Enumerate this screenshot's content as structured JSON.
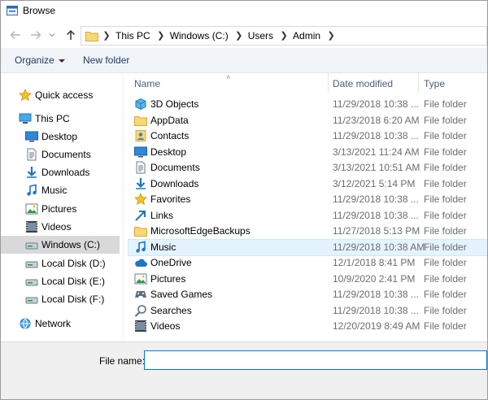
{
  "window": {
    "title": "Browse"
  },
  "address": {
    "crumbs": [
      "This PC",
      "Windows (C:)",
      "Users",
      "Admin"
    ]
  },
  "toolbar": {
    "organize_label": "Organize",
    "new_folder_label": "New folder"
  },
  "nav": {
    "items": [
      {
        "label": "Quick access",
        "icon": "star-icon"
      },
      {
        "label": "This PC",
        "icon": "computer-icon"
      },
      {
        "label": "Desktop",
        "icon": "desktop-icon"
      },
      {
        "label": "Documents",
        "icon": "documents-icon"
      },
      {
        "label": "Downloads",
        "icon": "download-icon"
      },
      {
        "label": "Music",
        "icon": "music-icon"
      },
      {
        "label": "Pictures",
        "icon": "pictures-icon"
      },
      {
        "label": "Videos",
        "icon": "videos-icon"
      },
      {
        "label": "Windows (C:)",
        "icon": "drive-icon",
        "selected": true
      },
      {
        "label": "Local Disk (D:)",
        "icon": "drive-icon"
      },
      {
        "label": "Local Disk (E:)",
        "icon": "drive-icon"
      },
      {
        "label": "Local Disk (F:)",
        "icon": "drive-icon"
      },
      {
        "label": "Network",
        "icon": "network-icon"
      }
    ]
  },
  "columns": {
    "name": "Name",
    "date": "Date modified",
    "type": "Type"
  },
  "files": [
    {
      "name": "3D Objects",
      "date": "11/29/2018 10:38 ...",
      "type": "File folder",
      "icon": "cube-folder-icon"
    },
    {
      "name": "AppData",
      "date": "11/23/2018 6:20 AM",
      "type": "File folder",
      "icon": "folder-icon"
    },
    {
      "name": "Contacts",
      "date": "11/29/2018 10:38 ...",
      "type": "File folder",
      "icon": "contacts-icon"
    },
    {
      "name": "Desktop",
      "date": "3/13/2021 11:24 AM",
      "type": "File folder",
      "icon": "desktop-icon"
    },
    {
      "name": "Documents",
      "date": "3/13/2021 10:51 AM",
      "type": "File folder",
      "icon": "documents-icon"
    },
    {
      "name": "Downloads",
      "date": "3/12/2021 5:14 PM",
      "type": "File folder",
      "icon": "download-icon"
    },
    {
      "name": "Favorites",
      "date": "11/29/2018 10:38 ...",
      "type": "File folder",
      "icon": "star-icon"
    },
    {
      "name": "Links",
      "date": "11/29/2018 10:38 ...",
      "type": "File folder",
      "icon": "links-icon"
    },
    {
      "name": "MicrosoftEdgeBackups",
      "date": "11/27/2018 5:13 PM",
      "type": "File folder",
      "icon": "folder-icon"
    },
    {
      "name": "Music",
      "date": "11/29/2018 10:38 AM",
      "type": "File folder",
      "icon": "music-icon",
      "hover": true
    },
    {
      "name": "OneDrive",
      "date": "12/1/2018 8:41 PM",
      "type": "File folder",
      "icon": "cloud-icon"
    },
    {
      "name": "Pictures",
      "date": "10/9/2020 2:41 PM",
      "type": "File folder",
      "icon": "pictures-icon"
    },
    {
      "name": "Saved Games",
      "date": "11/29/2018 10:38 ...",
      "type": "File folder",
      "icon": "games-icon"
    },
    {
      "name": "Searches",
      "date": "11/29/2018 10:38 ...",
      "type": "File folder",
      "icon": "search-icon"
    },
    {
      "name": "Videos",
      "date": "12/20/2019 8:49 AM",
      "type": "File folder",
      "icon": "videos-icon"
    }
  ],
  "filename": {
    "label": "File name:",
    "value": ""
  }
}
